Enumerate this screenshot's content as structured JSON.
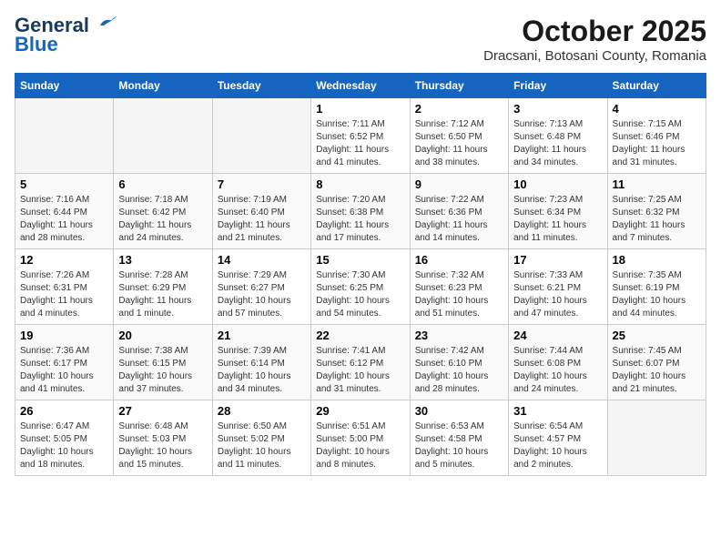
{
  "header": {
    "logo_line1": "General",
    "logo_line2": "Blue",
    "month": "October 2025",
    "location": "Dracsani, Botosani County, Romania"
  },
  "columns": [
    "Sunday",
    "Monday",
    "Tuesday",
    "Wednesday",
    "Thursday",
    "Friday",
    "Saturday"
  ],
  "weeks": [
    [
      {
        "day": "",
        "sunrise": "",
        "sunset": "",
        "daylight": ""
      },
      {
        "day": "",
        "sunrise": "",
        "sunset": "",
        "daylight": ""
      },
      {
        "day": "",
        "sunrise": "",
        "sunset": "",
        "daylight": ""
      },
      {
        "day": "1",
        "sunrise": "7:11 AM",
        "sunset": "6:52 PM",
        "daylight": "11 hours and 41 minutes."
      },
      {
        "day": "2",
        "sunrise": "7:12 AM",
        "sunset": "6:50 PM",
        "daylight": "11 hours and 38 minutes."
      },
      {
        "day": "3",
        "sunrise": "7:13 AM",
        "sunset": "6:48 PM",
        "daylight": "11 hours and 34 minutes."
      },
      {
        "day": "4",
        "sunrise": "7:15 AM",
        "sunset": "6:46 PM",
        "daylight": "11 hours and 31 minutes."
      }
    ],
    [
      {
        "day": "5",
        "sunrise": "7:16 AM",
        "sunset": "6:44 PM",
        "daylight": "11 hours and 28 minutes."
      },
      {
        "day": "6",
        "sunrise": "7:18 AM",
        "sunset": "6:42 PM",
        "daylight": "11 hours and 24 minutes."
      },
      {
        "day": "7",
        "sunrise": "7:19 AM",
        "sunset": "6:40 PM",
        "daylight": "11 hours and 21 minutes."
      },
      {
        "day": "8",
        "sunrise": "7:20 AM",
        "sunset": "6:38 PM",
        "daylight": "11 hours and 17 minutes."
      },
      {
        "day": "9",
        "sunrise": "7:22 AM",
        "sunset": "6:36 PM",
        "daylight": "11 hours and 14 minutes."
      },
      {
        "day": "10",
        "sunrise": "7:23 AM",
        "sunset": "6:34 PM",
        "daylight": "11 hours and 11 minutes."
      },
      {
        "day": "11",
        "sunrise": "7:25 AM",
        "sunset": "6:32 PM",
        "daylight": "11 hours and 7 minutes."
      }
    ],
    [
      {
        "day": "12",
        "sunrise": "7:26 AM",
        "sunset": "6:31 PM",
        "daylight": "11 hours and 4 minutes."
      },
      {
        "day": "13",
        "sunrise": "7:28 AM",
        "sunset": "6:29 PM",
        "daylight": "11 hours and 1 minute."
      },
      {
        "day": "14",
        "sunrise": "7:29 AM",
        "sunset": "6:27 PM",
        "daylight": "10 hours and 57 minutes."
      },
      {
        "day": "15",
        "sunrise": "7:30 AM",
        "sunset": "6:25 PM",
        "daylight": "10 hours and 54 minutes."
      },
      {
        "day": "16",
        "sunrise": "7:32 AM",
        "sunset": "6:23 PM",
        "daylight": "10 hours and 51 minutes."
      },
      {
        "day": "17",
        "sunrise": "7:33 AM",
        "sunset": "6:21 PM",
        "daylight": "10 hours and 47 minutes."
      },
      {
        "day": "18",
        "sunrise": "7:35 AM",
        "sunset": "6:19 PM",
        "daylight": "10 hours and 44 minutes."
      }
    ],
    [
      {
        "day": "19",
        "sunrise": "7:36 AM",
        "sunset": "6:17 PM",
        "daylight": "10 hours and 41 minutes."
      },
      {
        "day": "20",
        "sunrise": "7:38 AM",
        "sunset": "6:15 PM",
        "daylight": "10 hours and 37 minutes."
      },
      {
        "day": "21",
        "sunrise": "7:39 AM",
        "sunset": "6:14 PM",
        "daylight": "10 hours and 34 minutes."
      },
      {
        "day": "22",
        "sunrise": "7:41 AM",
        "sunset": "6:12 PM",
        "daylight": "10 hours and 31 minutes."
      },
      {
        "day": "23",
        "sunrise": "7:42 AM",
        "sunset": "6:10 PM",
        "daylight": "10 hours and 28 minutes."
      },
      {
        "day": "24",
        "sunrise": "7:44 AM",
        "sunset": "6:08 PM",
        "daylight": "10 hours and 24 minutes."
      },
      {
        "day": "25",
        "sunrise": "7:45 AM",
        "sunset": "6:07 PM",
        "daylight": "10 hours and 21 minutes."
      }
    ],
    [
      {
        "day": "26",
        "sunrise": "6:47 AM",
        "sunset": "5:05 PM",
        "daylight": "10 hours and 18 minutes."
      },
      {
        "day": "27",
        "sunrise": "6:48 AM",
        "sunset": "5:03 PM",
        "daylight": "10 hours and 15 minutes."
      },
      {
        "day": "28",
        "sunrise": "6:50 AM",
        "sunset": "5:02 PM",
        "daylight": "10 hours and 11 minutes."
      },
      {
        "day": "29",
        "sunrise": "6:51 AM",
        "sunset": "5:00 PM",
        "daylight": "10 hours and 8 minutes."
      },
      {
        "day": "30",
        "sunrise": "6:53 AM",
        "sunset": "4:58 PM",
        "daylight": "10 hours and 5 minutes."
      },
      {
        "day": "31",
        "sunrise": "6:54 AM",
        "sunset": "4:57 PM",
        "daylight": "10 hours and 2 minutes."
      },
      {
        "day": "",
        "sunrise": "",
        "sunset": "",
        "daylight": ""
      }
    ]
  ]
}
